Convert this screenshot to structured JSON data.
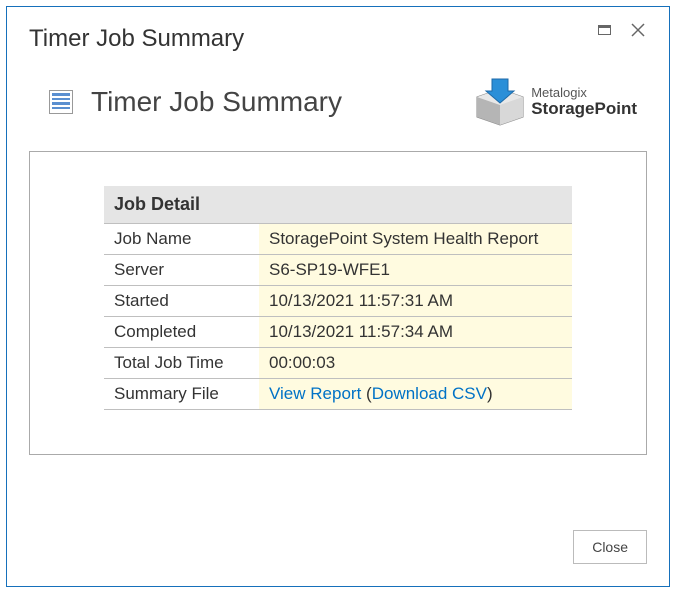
{
  "window": {
    "title": "Timer Job Summary",
    "close_button_label": "Close"
  },
  "heading": "Timer Job Summary",
  "brand": {
    "line1": "Metalogix",
    "line2": "StoragePoint"
  },
  "job_detail": {
    "section_title": "Job Detail",
    "rows": {
      "job_name": {
        "label": "Job Name",
        "value": "StoragePoint System Health Report"
      },
      "server": {
        "label": "Server",
        "value": "S6-SP19-WFE1"
      },
      "started": {
        "label": "Started",
        "value": "10/13/2021 11:57:31 AM"
      },
      "completed": {
        "label": "Completed",
        "value": "10/13/2021 11:57:34 AM"
      },
      "total_job_time": {
        "label": "Total Job Time",
        "value": "00:00:03"
      },
      "summary_file": {
        "label": "Summary File",
        "view_report_text": "View Report",
        "download_csv_text": "Download CSV"
      }
    }
  }
}
